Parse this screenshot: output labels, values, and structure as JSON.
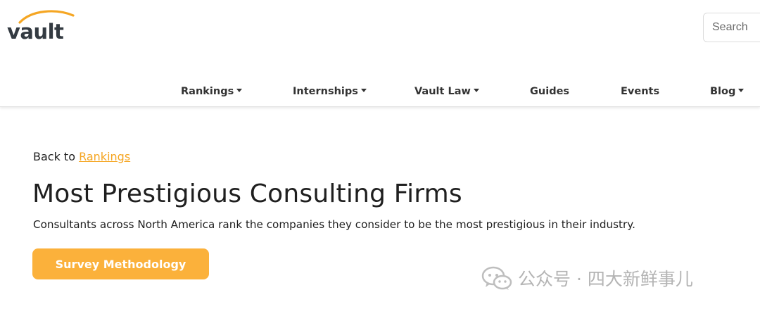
{
  "brand": {
    "logo_text": "vault",
    "accent_color": "#fbb13b"
  },
  "search": {
    "placeholder": "Search"
  },
  "nav": {
    "items": [
      {
        "label": "Rankings",
        "has_dropdown": true
      },
      {
        "label": "Internships",
        "has_dropdown": true
      },
      {
        "label": "Vault Law",
        "has_dropdown": true
      },
      {
        "label": "Guides",
        "has_dropdown": false
      },
      {
        "label": "Events",
        "has_dropdown": false
      },
      {
        "label": "Blog",
        "has_dropdown": true
      }
    ]
  },
  "breadcrumb": {
    "prefix": "Back to",
    "link_label": "Rankings"
  },
  "page": {
    "title": "Most Prestigious Consulting Firms",
    "subtitle": "Consultants across North America rank the companies they consider to be the most prestigious in their industry.",
    "button_label": "Survey Methodology"
  },
  "watermark": {
    "text": "公众号 · 四大新鲜事儿",
    "icon": "wechat-icon"
  }
}
